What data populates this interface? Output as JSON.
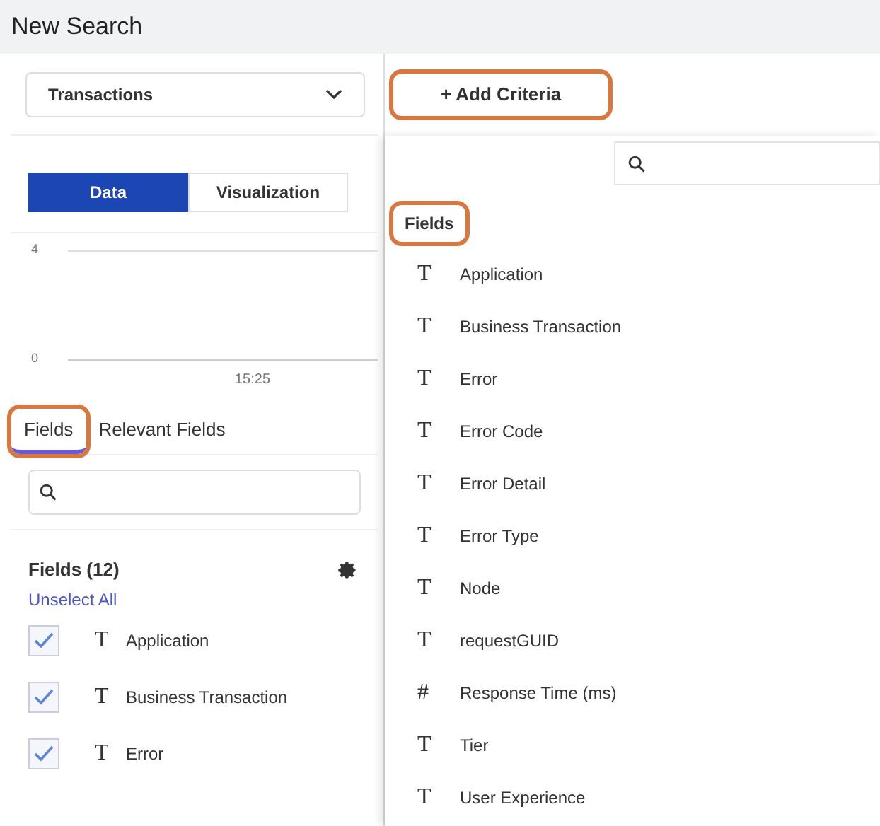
{
  "title": "New Search",
  "source_select": {
    "value": "Transactions"
  },
  "add_criteria": {
    "label": "+ Add Criteria",
    "highlighted": true
  },
  "view_tabs": [
    {
      "label": "Data",
      "selected": true
    },
    {
      "label": "Visualization",
      "selected": false
    }
  ],
  "chart": {
    "y_labels": [
      "4",
      "0"
    ],
    "x_label": "15:25"
  },
  "field_tabs": [
    {
      "label": "Fields",
      "selected": true,
      "highlighted": true
    },
    {
      "label": "Relevant Fields",
      "selected": false,
      "highlighted": false
    }
  ],
  "fields_panel": {
    "heading": "Fields (12)",
    "link": "Unselect All",
    "rows": [
      {
        "type_glyph": "T",
        "name": "Application",
        "checked": true
      },
      {
        "type_glyph": "T",
        "name": "Business Transaction",
        "checked": true
      },
      {
        "type_glyph": "T",
        "name": "Error",
        "checked": true
      }
    ]
  },
  "criteria_menu": {
    "heading": "Fields",
    "heading_highlighted": true,
    "items": [
      {
        "type_glyph": "T",
        "name": "Application"
      },
      {
        "type_glyph": "T",
        "name": "Business Transaction"
      },
      {
        "type_glyph": "T",
        "name": "Error"
      },
      {
        "type_glyph": "T",
        "name": "Error Code"
      },
      {
        "type_glyph": "T",
        "name": "Error Detail"
      },
      {
        "type_glyph": "T",
        "name": "Error Type"
      },
      {
        "type_glyph": "T",
        "name": "Node"
      },
      {
        "type_glyph": "T",
        "name": "requestGUID"
      },
      {
        "type_glyph": "#",
        "name": "Response Time (ms)"
      },
      {
        "type_glyph": "T",
        "name": "Tier"
      },
      {
        "type_glyph": "T",
        "name": "User Experience"
      }
    ]
  }
}
